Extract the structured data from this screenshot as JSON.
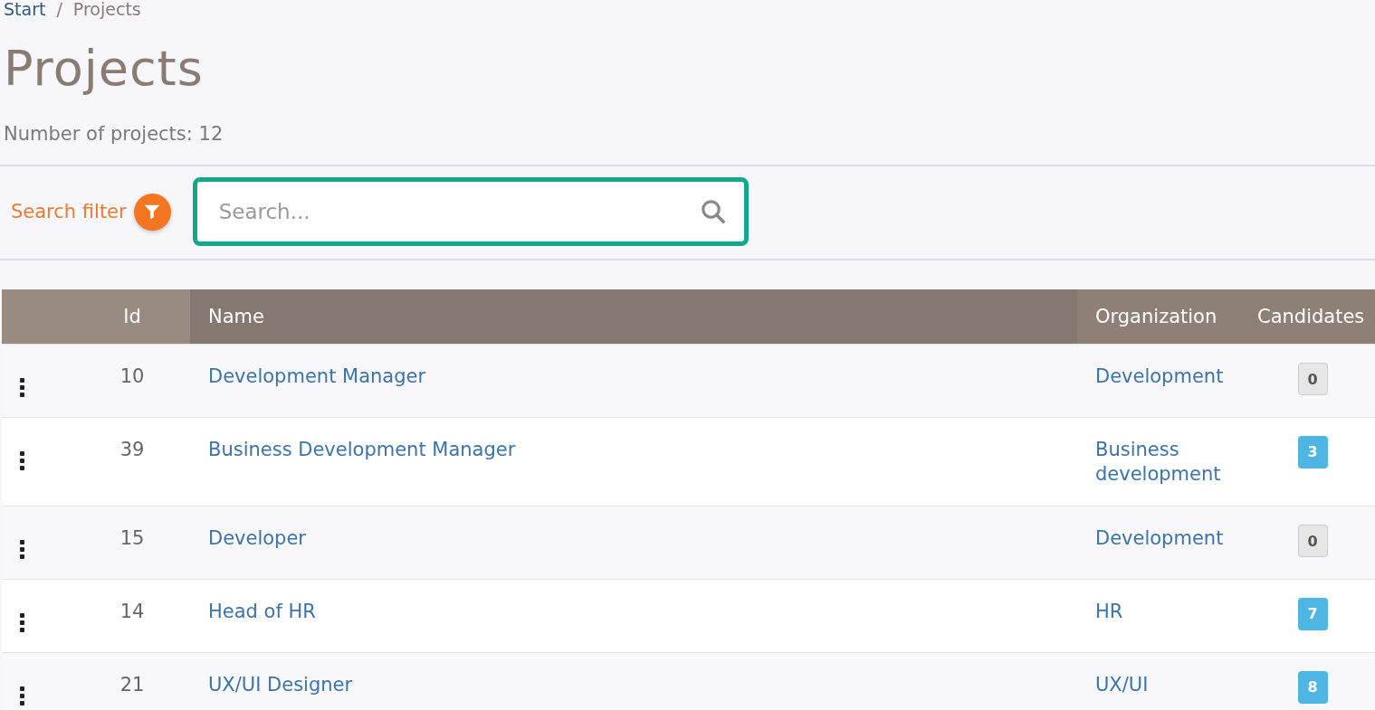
{
  "breadcrumb": {
    "separator": "/",
    "items": [
      {
        "label": "Start",
        "link": true
      },
      {
        "label": "Projects",
        "link": false
      }
    ]
  },
  "title": "Projects",
  "count_text": "Number of projects: 12",
  "search_filter": {
    "label": "Search filter",
    "placeholder": "Search..."
  },
  "table": {
    "columns": [
      "",
      "Id",
      "Name",
      "Organization",
      "Candidates"
    ],
    "rows": [
      {
        "id": "10",
        "name": "Development Manager",
        "organization": "Development",
        "candidates": "0",
        "color": "#e6e6e6"
      },
      {
        "id": "39",
        "name": "Business Development Manager",
        "organization": "Business development",
        "candidates": "3",
        "color": "#4fb6e3"
      },
      {
        "id": "15",
        "name": "Developer",
        "organization": "Development",
        "candidates": "0",
        "color": "#e6e6e6"
      },
      {
        "id": "14",
        "name": "Head of HR",
        "organization": "HR",
        "candidates": "7",
        "color": "#4fb6e3"
      },
      {
        "id": "21",
        "name": "UX/UI Designer",
        "organization": "UX/UI",
        "candidates": "8",
        "color": "#4fb6e3"
      }
    ]
  }
}
